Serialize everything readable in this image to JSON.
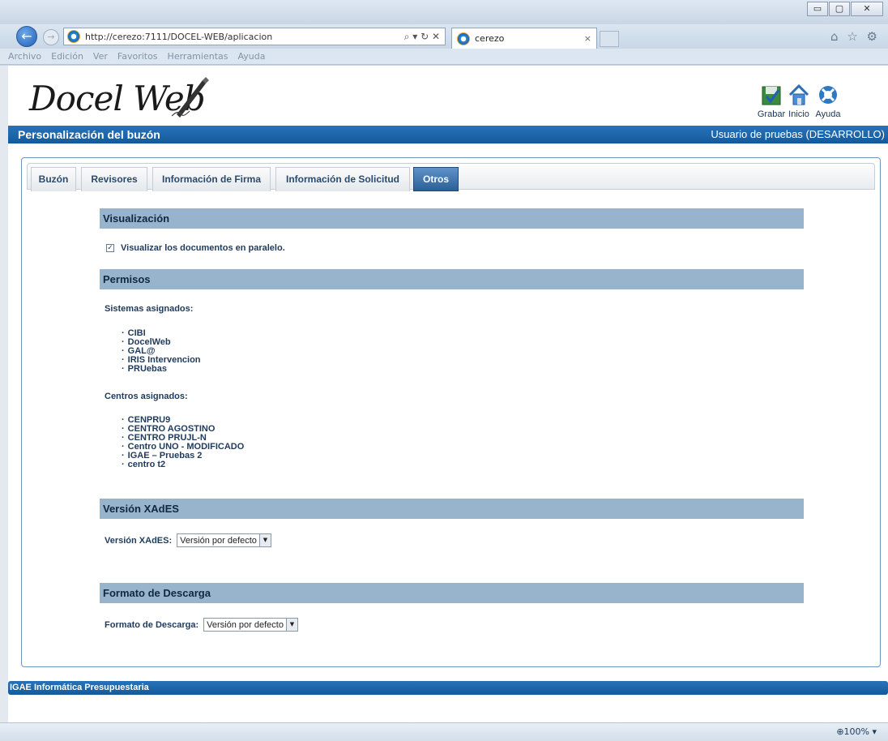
{
  "browser": {
    "window_buttons": [
      "▭",
      "▢",
      "✕"
    ],
    "address_url": "http://cerezo:7111/DOCEL-WEB/aplicacion",
    "address_controls": "⌕ ▾ ↻ ✕",
    "tab_title": "cerezo",
    "tab_close": "×",
    "tool_icons": "⌂ ☆ ⚙",
    "menu": [
      "Archivo",
      "Edición",
      "Ver",
      "Favoritos",
      "Herramientas",
      "Ayuda"
    ],
    "zoom": "⊕100%  ▾"
  },
  "app": {
    "logo_text": "Docel Web",
    "toolbar": {
      "save_label": "Grabar",
      "home_label": "Inicio",
      "help_label": "Ayuda"
    },
    "header_title": "Personalización del buzón",
    "user_label": "Usuario de pruebas (DESARROLLO)",
    "tabs": [
      "Buzón",
      "Revisores",
      "Información de Firma",
      "Información de Solicitud",
      "Otros"
    ],
    "active_tab": "Otros",
    "sections": {
      "visualizacion": {
        "title": "Visualización",
        "checkbox_label": "Visualizar los documentos en paralelo.",
        "checkbox_mark": "✓"
      },
      "permisos": {
        "title": "Permisos",
        "systems_label": "Sistemas asignados:",
        "systems": [
          "CIBI",
          "DocelWeb",
          "GAL@",
          "IRIS Intervencion",
          "PRUebas"
        ],
        "centers_label": "Centros asignados:",
        "centers": [
          "CENPRU9",
          "CENTRO AGOSTINO",
          "CENTRO PRUJL-N",
          "Centro UNO - MODIFICADO",
          "IGAE – Pruebas 2",
          "centro t2"
        ]
      },
      "xades": {
        "title": "Versión XAdES",
        "field_label": "Versión XAdES:",
        "selected": "Versión por defecto"
      },
      "descarga": {
        "title": "Formato de Descarga",
        "field_label": "Formato de Descarga:",
        "selected": "Versión por defecto"
      }
    },
    "dropdown_arrow": "▼",
    "footer_text": "IGAE Informática Presupuestaria"
  }
}
